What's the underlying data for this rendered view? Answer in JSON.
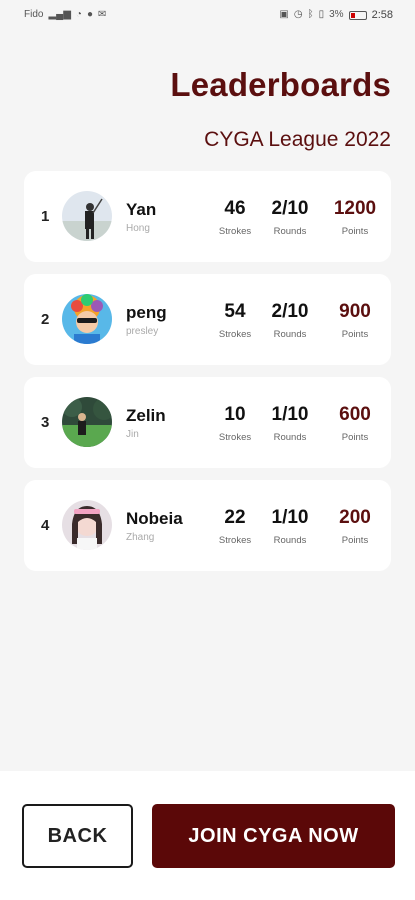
{
  "status_bar": {
    "carrier": "Fido",
    "battery_text": "3%",
    "time": "2:58"
  },
  "header": {
    "title": "Leaderboards",
    "league": "CYGA League 2022"
  },
  "labels": {
    "strokes": "Strokes",
    "rounds": "Rounds",
    "points": "Points"
  },
  "players": [
    {
      "rank": "1",
      "name": "Yan",
      "handle": "Hong",
      "strokes": "46",
      "rounds": "2/10",
      "points": "1200"
    },
    {
      "rank": "2",
      "name": "peng",
      "handle": "presley",
      "strokes": "54",
      "rounds": "2/10",
      "points": "900"
    },
    {
      "rank": "3",
      "name": "Zelin",
      "handle": "Jin",
      "strokes": "10",
      "rounds": "1/10",
      "points": "600"
    },
    {
      "rank": "4",
      "name": "Nobeia",
      "handle": "Zhang",
      "strokes": "22",
      "rounds": "1/10",
      "points": "200"
    }
  ],
  "footer": {
    "back_label": "BACK",
    "join_label": "JOIN CYGA NOW"
  },
  "colors": {
    "accent": "#5b0f0f",
    "join_button": "#5b0808"
  }
}
